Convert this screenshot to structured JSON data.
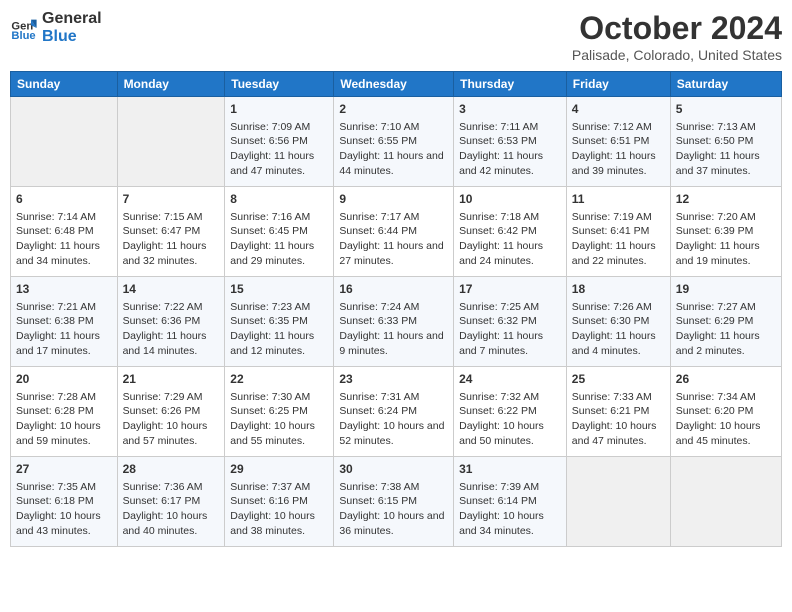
{
  "header": {
    "logo_line1": "General",
    "logo_line2": "Blue",
    "month": "October 2024",
    "location": "Palisade, Colorado, United States"
  },
  "days_of_week": [
    "Sunday",
    "Monday",
    "Tuesday",
    "Wednesday",
    "Thursday",
    "Friday",
    "Saturday"
  ],
  "weeks": [
    [
      {
        "day": "",
        "empty": true
      },
      {
        "day": "",
        "empty": true
      },
      {
        "day": "1",
        "sunrise": "Sunrise: 7:09 AM",
        "sunset": "Sunset: 6:56 PM",
        "daylight": "Daylight: 11 hours and 47 minutes."
      },
      {
        "day": "2",
        "sunrise": "Sunrise: 7:10 AM",
        "sunset": "Sunset: 6:55 PM",
        "daylight": "Daylight: 11 hours and 44 minutes."
      },
      {
        "day": "3",
        "sunrise": "Sunrise: 7:11 AM",
        "sunset": "Sunset: 6:53 PM",
        "daylight": "Daylight: 11 hours and 42 minutes."
      },
      {
        "day": "4",
        "sunrise": "Sunrise: 7:12 AM",
        "sunset": "Sunset: 6:51 PM",
        "daylight": "Daylight: 11 hours and 39 minutes."
      },
      {
        "day": "5",
        "sunrise": "Sunrise: 7:13 AM",
        "sunset": "Sunset: 6:50 PM",
        "daylight": "Daylight: 11 hours and 37 minutes."
      }
    ],
    [
      {
        "day": "6",
        "sunrise": "Sunrise: 7:14 AM",
        "sunset": "Sunset: 6:48 PM",
        "daylight": "Daylight: 11 hours and 34 minutes."
      },
      {
        "day": "7",
        "sunrise": "Sunrise: 7:15 AM",
        "sunset": "Sunset: 6:47 PM",
        "daylight": "Daylight: 11 hours and 32 minutes."
      },
      {
        "day": "8",
        "sunrise": "Sunrise: 7:16 AM",
        "sunset": "Sunset: 6:45 PM",
        "daylight": "Daylight: 11 hours and 29 minutes."
      },
      {
        "day": "9",
        "sunrise": "Sunrise: 7:17 AM",
        "sunset": "Sunset: 6:44 PM",
        "daylight": "Daylight: 11 hours and 27 minutes."
      },
      {
        "day": "10",
        "sunrise": "Sunrise: 7:18 AM",
        "sunset": "Sunset: 6:42 PM",
        "daylight": "Daylight: 11 hours and 24 minutes."
      },
      {
        "day": "11",
        "sunrise": "Sunrise: 7:19 AM",
        "sunset": "Sunset: 6:41 PM",
        "daylight": "Daylight: 11 hours and 22 minutes."
      },
      {
        "day": "12",
        "sunrise": "Sunrise: 7:20 AM",
        "sunset": "Sunset: 6:39 PM",
        "daylight": "Daylight: 11 hours and 19 minutes."
      }
    ],
    [
      {
        "day": "13",
        "sunrise": "Sunrise: 7:21 AM",
        "sunset": "Sunset: 6:38 PM",
        "daylight": "Daylight: 11 hours and 17 minutes."
      },
      {
        "day": "14",
        "sunrise": "Sunrise: 7:22 AM",
        "sunset": "Sunset: 6:36 PM",
        "daylight": "Daylight: 11 hours and 14 minutes."
      },
      {
        "day": "15",
        "sunrise": "Sunrise: 7:23 AM",
        "sunset": "Sunset: 6:35 PM",
        "daylight": "Daylight: 11 hours and 12 minutes."
      },
      {
        "day": "16",
        "sunrise": "Sunrise: 7:24 AM",
        "sunset": "Sunset: 6:33 PM",
        "daylight": "Daylight: 11 hours and 9 minutes."
      },
      {
        "day": "17",
        "sunrise": "Sunrise: 7:25 AM",
        "sunset": "Sunset: 6:32 PM",
        "daylight": "Daylight: 11 hours and 7 minutes."
      },
      {
        "day": "18",
        "sunrise": "Sunrise: 7:26 AM",
        "sunset": "Sunset: 6:30 PM",
        "daylight": "Daylight: 11 hours and 4 minutes."
      },
      {
        "day": "19",
        "sunrise": "Sunrise: 7:27 AM",
        "sunset": "Sunset: 6:29 PM",
        "daylight": "Daylight: 11 hours and 2 minutes."
      }
    ],
    [
      {
        "day": "20",
        "sunrise": "Sunrise: 7:28 AM",
        "sunset": "Sunset: 6:28 PM",
        "daylight": "Daylight: 10 hours and 59 minutes."
      },
      {
        "day": "21",
        "sunrise": "Sunrise: 7:29 AM",
        "sunset": "Sunset: 6:26 PM",
        "daylight": "Daylight: 10 hours and 57 minutes."
      },
      {
        "day": "22",
        "sunrise": "Sunrise: 7:30 AM",
        "sunset": "Sunset: 6:25 PM",
        "daylight": "Daylight: 10 hours and 55 minutes."
      },
      {
        "day": "23",
        "sunrise": "Sunrise: 7:31 AM",
        "sunset": "Sunset: 6:24 PM",
        "daylight": "Daylight: 10 hours and 52 minutes."
      },
      {
        "day": "24",
        "sunrise": "Sunrise: 7:32 AM",
        "sunset": "Sunset: 6:22 PM",
        "daylight": "Daylight: 10 hours and 50 minutes."
      },
      {
        "day": "25",
        "sunrise": "Sunrise: 7:33 AM",
        "sunset": "Sunset: 6:21 PM",
        "daylight": "Daylight: 10 hours and 47 minutes."
      },
      {
        "day": "26",
        "sunrise": "Sunrise: 7:34 AM",
        "sunset": "Sunset: 6:20 PM",
        "daylight": "Daylight: 10 hours and 45 minutes."
      }
    ],
    [
      {
        "day": "27",
        "sunrise": "Sunrise: 7:35 AM",
        "sunset": "Sunset: 6:18 PM",
        "daylight": "Daylight: 10 hours and 43 minutes."
      },
      {
        "day": "28",
        "sunrise": "Sunrise: 7:36 AM",
        "sunset": "Sunset: 6:17 PM",
        "daylight": "Daylight: 10 hours and 40 minutes."
      },
      {
        "day": "29",
        "sunrise": "Sunrise: 7:37 AM",
        "sunset": "Sunset: 6:16 PM",
        "daylight": "Daylight: 10 hours and 38 minutes."
      },
      {
        "day": "30",
        "sunrise": "Sunrise: 7:38 AM",
        "sunset": "Sunset: 6:15 PM",
        "daylight": "Daylight: 10 hours and 36 minutes."
      },
      {
        "day": "31",
        "sunrise": "Sunrise: 7:39 AM",
        "sunset": "Sunset: 6:14 PM",
        "daylight": "Daylight: 10 hours and 34 minutes."
      },
      {
        "day": "",
        "empty": true
      },
      {
        "day": "",
        "empty": true
      }
    ]
  ]
}
